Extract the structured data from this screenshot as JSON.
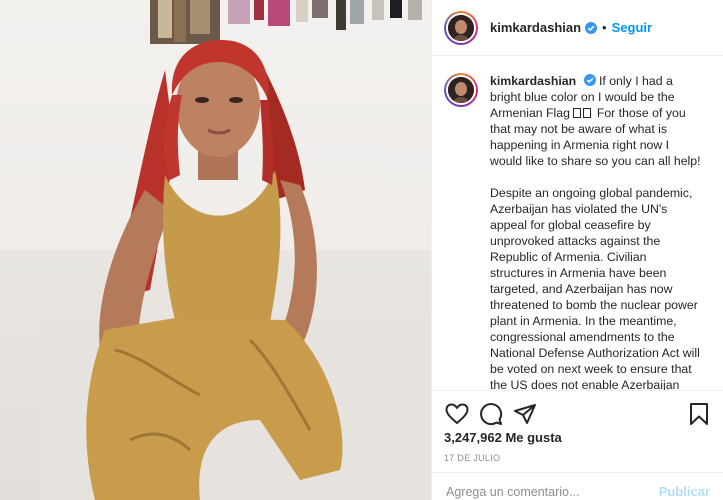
{
  "photo": {
    "alt_icon": "post-photo"
  },
  "header": {
    "username": "kimkardashian",
    "separator": "•",
    "follow_label": "Seguir"
  },
  "caption": {
    "username": "kimkardashian",
    "paragraph1_before_flag": "If only I had a bright blue color on I would be the Armenian Flag",
    "paragraph1_after_flag": "For those of you that may not be aware of what is happening in Armenia right now I would like to share so you can all help!",
    "paragraph2": "Despite an ongoing global pandemic, Azerbaijan has violated the UN's appeal for global ceasefire by unprovoked attacks against the Republic of Armenia. Civilian structures in Armenia have been targeted, and Azerbaijan has now threatened to bomb the nuclear power plant in Armenia. In the meantime, congressional amendments to the National Defense Authorization Act will be voted on next week to ensure that the US does not enable Azerbaijan with"
  },
  "actions": {
    "like_icon": "heart-icon",
    "comment_icon": "comment-icon",
    "share_icon": "share-icon",
    "save_icon": "bookmark-icon"
  },
  "likes": "3,247,962 Me gusta",
  "date": "17 de julio",
  "comment_box": {
    "placeholder": "Agrega un comentario...",
    "post_label": "Publicar"
  },
  "colors": {
    "accent": "#0095f6",
    "post_disabled": "#b2dffc",
    "muted": "#8e8e8e",
    "text": "#262626"
  }
}
